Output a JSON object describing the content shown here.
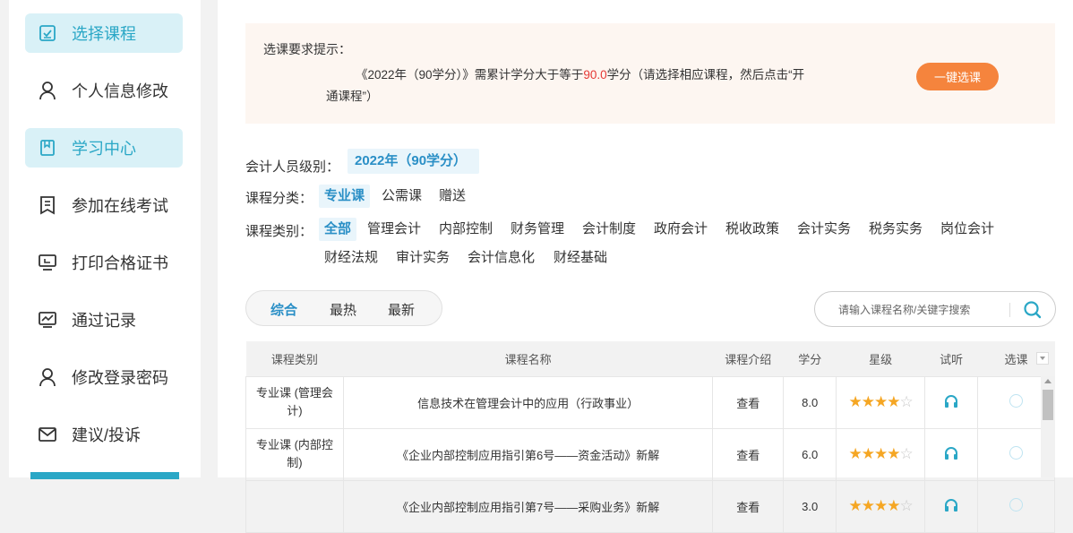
{
  "sidebar": {
    "items": [
      {
        "label": "选择课程",
        "icon": "checkbox-icon",
        "active": true
      },
      {
        "label": "个人信息修改",
        "icon": "user-icon",
        "active": false
      },
      {
        "label": "学习中心",
        "icon": "book-icon",
        "active": true
      },
      {
        "label": "参加在线考试",
        "icon": "exam-icon",
        "active": false
      },
      {
        "label": "打印合格证书",
        "icon": "monitor-icon",
        "active": false
      },
      {
        "label": "通过记录",
        "icon": "chart-icon",
        "active": false
      },
      {
        "label": "修改登录密码",
        "icon": "user-icon",
        "active": false
      },
      {
        "label": "建议/投诉",
        "icon": "mail-icon",
        "active": false
      }
    ]
  },
  "notice": {
    "title": "选课要求提示：",
    "text_part1": "《2022年（90学分）》需累计学分大于等于",
    "required_credits": "90.0",
    "text_part2": "学分（请选择相应课程，然后点击“开",
    "text_part3": "通课程”）",
    "button_label": "一键选课"
  },
  "filters": {
    "level_label": "会计人员级别：",
    "level_value": "2022年（90学分）",
    "category_label": "课程分类：",
    "categories": [
      "专业课",
      "公需课",
      "赠送"
    ],
    "type_label": "课程类别：",
    "types": [
      "全部",
      "管理会计",
      "内部控制",
      "财务管理",
      "会计制度",
      "政府会计",
      "税收政策",
      "会计实务",
      "税务实务",
      "岗位会计",
      "财经法规",
      "审计实务",
      "会计信息化",
      "财经基础"
    ]
  },
  "sort": {
    "tabs": [
      "综合",
      "最热",
      "最新"
    ]
  },
  "search": {
    "placeholder": "请输入课程名称/关键字搜索"
  },
  "table": {
    "headers": [
      "课程类别",
      "课程名称",
      "课程介绍",
      "学分",
      "星级",
      "试听",
      "选课"
    ],
    "rows": [
      {
        "category": "专业课 (管理会计)",
        "name": "信息技术在管理会计中的应用（行政事业）",
        "intro": "查看",
        "credits": "8.0",
        "stars": 4
      },
      {
        "category": "专业课 (内部控制)",
        "name": "《企业内部控制应用指引第6号——资金活动》新解",
        "intro": "查看",
        "credits": "6.0",
        "stars": 4
      },
      {
        "category": "",
        "name": "《企业内部控制应用指引第7号——采购业务》新解",
        "intro": "查看",
        "credits": "3.0",
        "stars": 4
      }
    ]
  },
  "colors": {
    "accent": "#2aa7c6",
    "link": "#2a8fc6",
    "button": "#f5843d",
    "highlight": "#e53935",
    "star": "#f5a623"
  }
}
